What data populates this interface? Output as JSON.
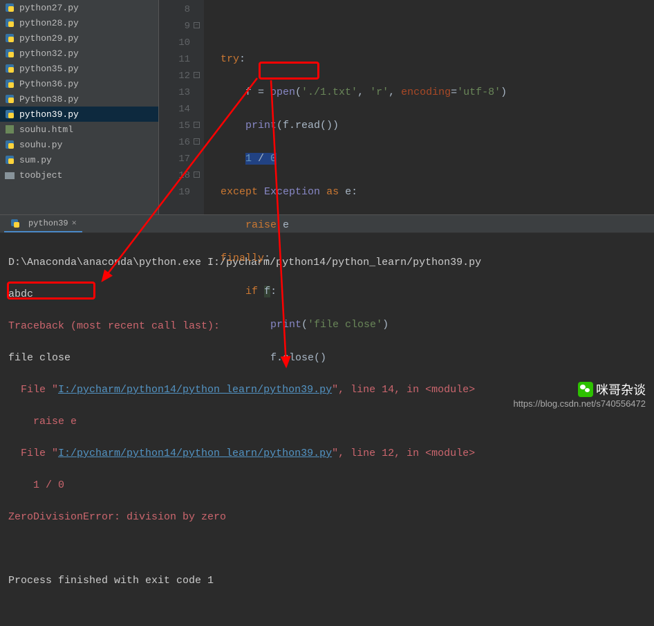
{
  "file_tree": {
    "items": [
      {
        "name": "python27.py",
        "type": "py"
      },
      {
        "name": "python28.py",
        "type": "py"
      },
      {
        "name": "python29.py",
        "type": "py"
      },
      {
        "name": "python32.py",
        "type": "py"
      },
      {
        "name": "python35.py",
        "type": "py"
      },
      {
        "name": "Python36.py",
        "type": "py"
      },
      {
        "name": "Python38.py",
        "type": "py"
      },
      {
        "name": "python39.py",
        "type": "py",
        "selected": true
      },
      {
        "name": "souhu.html",
        "type": "html"
      },
      {
        "name": "souhu.py",
        "type": "py"
      },
      {
        "name": "sum.py",
        "type": "py"
      },
      {
        "name": "toobject",
        "type": "folder"
      }
    ]
  },
  "editor": {
    "lines": [
      {
        "num": "8",
        "code": ""
      },
      {
        "num": "9",
        "code": "try:",
        "fold": true
      },
      {
        "num": "10",
        "code": "    f = open('./1.txt', 'r', encoding='utf-8')"
      },
      {
        "num": "11",
        "code": "    print(f.read())"
      },
      {
        "num": "12",
        "code": "    1 / 0",
        "fold": true,
        "boxed": true
      },
      {
        "num": "13",
        "code": "except Exception as e:"
      },
      {
        "num": "14",
        "code": "    raise e"
      },
      {
        "num": "15",
        "code": "finally:",
        "fold": true
      },
      {
        "num": "16",
        "code": "    if f:",
        "fold": true
      },
      {
        "num": "17",
        "code": "        print('file close')"
      },
      {
        "num": "18",
        "code": "        f.close()",
        "fold": true
      },
      {
        "num": "19",
        "code": ""
      }
    ]
  },
  "terminal": {
    "tab_name": "python39",
    "output": {
      "line1": "D:\\Anaconda\\anaconda\\python.exe I:/pycharm/python14/python_learn/python39.py",
      "line2": "abdc",
      "traceback_header": "Traceback (most recent call last):",
      "file_close": "file close",
      "file1_prefix": "  File \"",
      "file1_link": "I:/pycharm/python14/python_learn/python39.py",
      "file1_suffix": "\", line 14, in <module>",
      "raise_line": "    raise e",
      "file2_prefix": "  File \"",
      "file2_link": "I:/pycharm/python14/python_learn/python39.py",
      "file2_suffix": "\", line 12, in <module>",
      "div_line": "    1 / 0",
      "error_line": "ZeroDivisionError: division by zero",
      "exit_line": "Process finished with exit code 1"
    }
  },
  "watermark": {
    "top": "咪哥杂谈",
    "bottom": "https://blog.csdn.net/s740556472"
  }
}
